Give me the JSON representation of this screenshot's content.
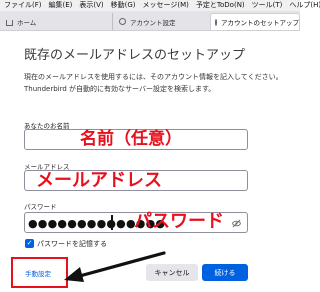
{
  "menubar": [
    "ファイル(F)",
    "編集(E)",
    "表示(V)",
    "移動(G)",
    "メッセージ(M)",
    "予定とToDo(N)",
    "ツール(T)",
    "ヘルプ(H)"
  ],
  "tabs": {
    "home": "ホーム",
    "account_settings": "アカウント設定",
    "new_account": "アカウントのセットアップ"
  },
  "page": {
    "title": "既存のメールアドレスのセットアップ",
    "description_line1": "現在のメールアドレスを使用するには、そのアカウント情報を記入してください。",
    "description_line2": "Thunderbird が自動的に有効なサーバー設定を検索します。"
  },
  "form": {
    "name_label": "あなたのお名前",
    "email_label": "メールアドレス",
    "password_label": "パスワード",
    "password_value": "●●●●●●●●●●●●●●",
    "remember_label": "パスワードを記憶する",
    "remember_checked": true
  },
  "overlays": {
    "name": "名前（任意）",
    "email": "メールアドレス",
    "password": "パスワード"
  },
  "buttons": {
    "manual": "手動設定",
    "cancel": "キャンセル",
    "continue": "続ける"
  },
  "colors": {
    "accent": "#0061e0",
    "annotation": "#e8101c"
  }
}
